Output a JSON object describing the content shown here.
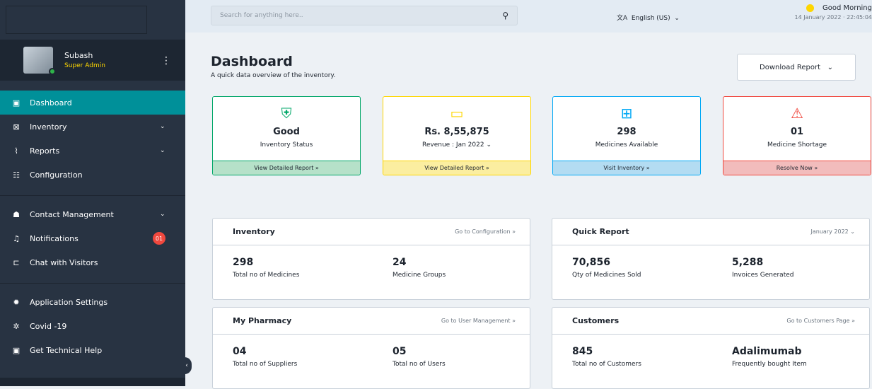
{
  "sidebar": {
    "user": {
      "name": "Subash",
      "role": "Super Admin"
    },
    "items": [
      {
        "label": "Dashboard",
        "icon": "dashboard-icon",
        "glyph": "▣",
        "active": true
      },
      {
        "label": "Inventory",
        "icon": "inventory-icon",
        "glyph": "⊠",
        "chevron": true
      },
      {
        "label": "Reports",
        "icon": "reports-icon",
        "glyph": "⌇",
        "chevron": true
      },
      {
        "label": "Configuration",
        "icon": "configuration-icon",
        "glyph": "☷"
      },
      {
        "label": "Contact Management",
        "icon": "contact-icon",
        "glyph": "☗",
        "chevron": true
      },
      {
        "label": "Notifications",
        "icon": "bell-icon",
        "glyph": "♫",
        "badge": "01"
      },
      {
        "label": "Chat with Visitors",
        "icon": "chat-icon",
        "glyph": "⊏"
      },
      {
        "label": "Application Settings",
        "icon": "settings-icon",
        "glyph": "✹"
      },
      {
        "label": "Covid -19",
        "icon": "covid-icon",
        "glyph": "✲"
      },
      {
        "label": "Get Technical Help",
        "icon": "help-icon",
        "glyph": "▣"
      }
    ]
  },
  "topbar": {
    "search_placeholder": "Search for anything here..",
    "language": "English (US)",
    "greeting": "Good Morning",
    "datetime": "14 January 2022 · 22:45:04"
  },
  "header": {
    "title": "Dashboard",
    "subtitle": "A quick data overview of the inventory.",
    "download_label": "Download Report"
  },
  "stats": [
    {
      "value": "Good",
      "label": "Inventory Status",
      "footer": "View Detailed Report  »",
      "icon": "shield-plus-icon",
      "glyph": "⛨",
      "color": "#01a768",
      "bg": "#b6e1c9"
    },
    {
      "value": "Rs. 8,55,875",
      "label": "Revenue : Jan 2022",
      "footer": "View Detailed Report  »",
      "icon": "money-icon",
      "glyph": "▭",
      "color": "#fed600",
      "bg": "#fbeea0"
    },
    {
      "value": "298",
      "label": "Medicines Available",
      "footer": "Visit Inventory  »",
      "icon": "medkit-icon",
      "glyph": "⊞",
      "color": "#03a9f5",
      "bg": "#b3dcf2"
    },
    {
      "value": "01",
      "label": "Medicine Shortage",
      "footer": "Resolve Now  »",
      "icon": "warning-icon",
      "glyph": "⚠",
      "color": "#f0483e",
      "bg": "#f2bcbc"
    }
  ],
  "cards": {
    "inventory": {
      "title": "Inventory",
      "link": "Go to Configuration  »",
      "metrics": [
        {
          "value": "298",
          "label": "Total no of Medicines"
        },
        {
          "value": "24",
          "label": "Medicine Groups"
        }
      ]
    },
    "quick_report": {
      "title": "Quick Report",
      "link": "January 2022  ⌄",
      "metrics": [
        {
          "value": "70,856",
          "label": "Qty of Medicines Sold"
        },
        {
          "value": "5,288",
          "label": "Invoices Generated"
        }
      ]
    },
    "pharmacy": {
      "title": "My Pharmacy",
      "link": "Go to User Management  »",
      "metrics": [
        {
          "value": "04",
          "label": "Total no of Suppliers"
        },
        {
          "value": "05",
          "label": "Total no of Users"
        }
      ]
    },
    "customers": {
      "title": "Customers",
      "link": "Go to Customers Page  »",
      "metrics": [
        {
          "value": "845",
          "label": "Total no of Customers"
        },
        {
          "value": "Adalimumab",
          "label": "Frequently bought Item"
        }
      ]
    }
  }
}
